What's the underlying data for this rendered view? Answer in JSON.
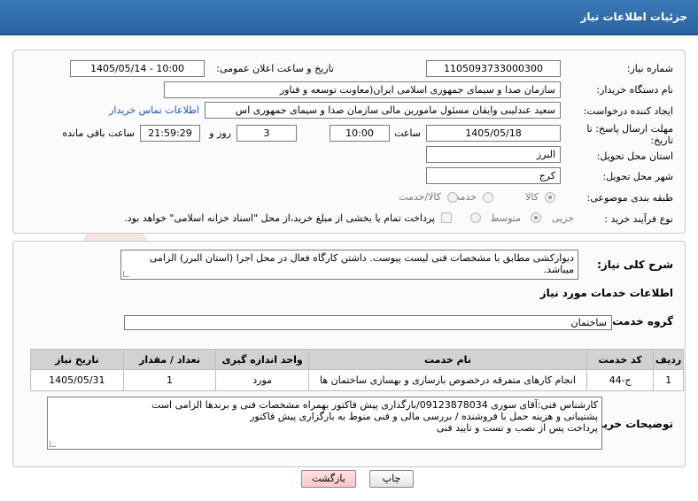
{
  "header": {
    "title": "جزئیات اطلاعات نیاز"
  },
  "form": {
    "need_number_label": "شماره نیاز:",
    "need_number": "1105093733000300",
    "announce_label": "تاریخ و ساعت اعلان عمومی:",
    "announce_value": "1405/05/14 - 10:00",
    "buyer_label": "نام دستگاه خریدار:",
    "buyer_value": "سازمان صدا و سیمای جمهوری اسلامی ایران(معاونت توسعه و فناور",
    "creator_label": "ایجاد کننده درخواست:",
    "creator_value": "سعید عندلیبی وایقان مسئول مامورین مالی  سازمان صدا و سیمای جمهوری اس",
    "contact_link": "اطلاعات تماس خریدار",
    "deadline_label_1": "مهلت ارسال پاسخ: تا",
    "deadline_label_2": "تاریخ:",
    "deadline_date": "1405/05/18",
    "time_label": "ساعت",
    "deadline_time": "10:00",
    "days_value": "3",
    "days_label": "روز و",
    "remaining_time": "21:59:29",
    "remaining_label": "ساعت باقی مانده",
    "province_label": "استان محل تحویل:",
    "province_value": "البرز",
    "city_label": "شهر محل تحویل:",
    "city_value": "کرج",
    "category_label": "طبقه بندی موضوعی:",
    "category_options": [
      "کالا",
      "خدمت",
      "کالا/خدمت"
    ],
    "category_selected": "کالا",
    "process_label": "نوع فرآیند خرید :",
    "process_options": [
      "جزیی",
      "متوسط"
    ],
    "process_selected": "جزیی",
    "payment_note": "پرداخت تمام یا بخشی از مبلغ خرید،از محل \"اسناد خزانه اسلامی\" خواهد بود."
  },
  "description": {
    "label": "شرح کلی نیاز:",
    "lines": [
      "دیوارکشی مطابق با مشخصات فنی لیست پیوست. داشتن کارگاه فعال در محل اجرا (استان البرز) الزامی",
      "میباشد."
    ]
  },
  "services": {
    "section_title": "اطلاعات خدمات مورد نیاز",
    "group_label": "گروه خدمت:",
    "group_value": "ساختمان",
    "columns": [
      "ردیف",
      "کد خدمت",
      "نام خدمت",
      "واحد اندازه گیری",
      "تعداد / مقدار",
      "تاریخ نیاز"
    ],
    "rows": [
      [
        "1",
        "ج-44",
        "انجام کارهای متفرقه درخصوص بازسازی و بهسازی ساختمان ها",
        "مورد",
        "1",
        "1405/05/31"
      ]
    ]
  },
  "buyer_notes": {
    "label": "توضیحات خریدار:",
    "lines": [
      "کارشناس فنی:آقای سوری 09123878034/بارگذاری پیش فاکتور بهمراه مشخصات فنی و برندها الزامی است",
      "پشتیبانی و هزینه حمل با فروشنده / بررسی مالی و فنی منوط به بارگزاری پیش فاکتور",
      "پرداخت پس از نصب و تست و تایید فنی"
    ]
  },
  "buttons": {
    "print": "چاپ",
    "back": "بازگشت"
  },
  "colors": {
    "header": "#2f6aa8",
    "link": "#1a56b8",
    "table_header": "#d2d2d2"
  }
}
